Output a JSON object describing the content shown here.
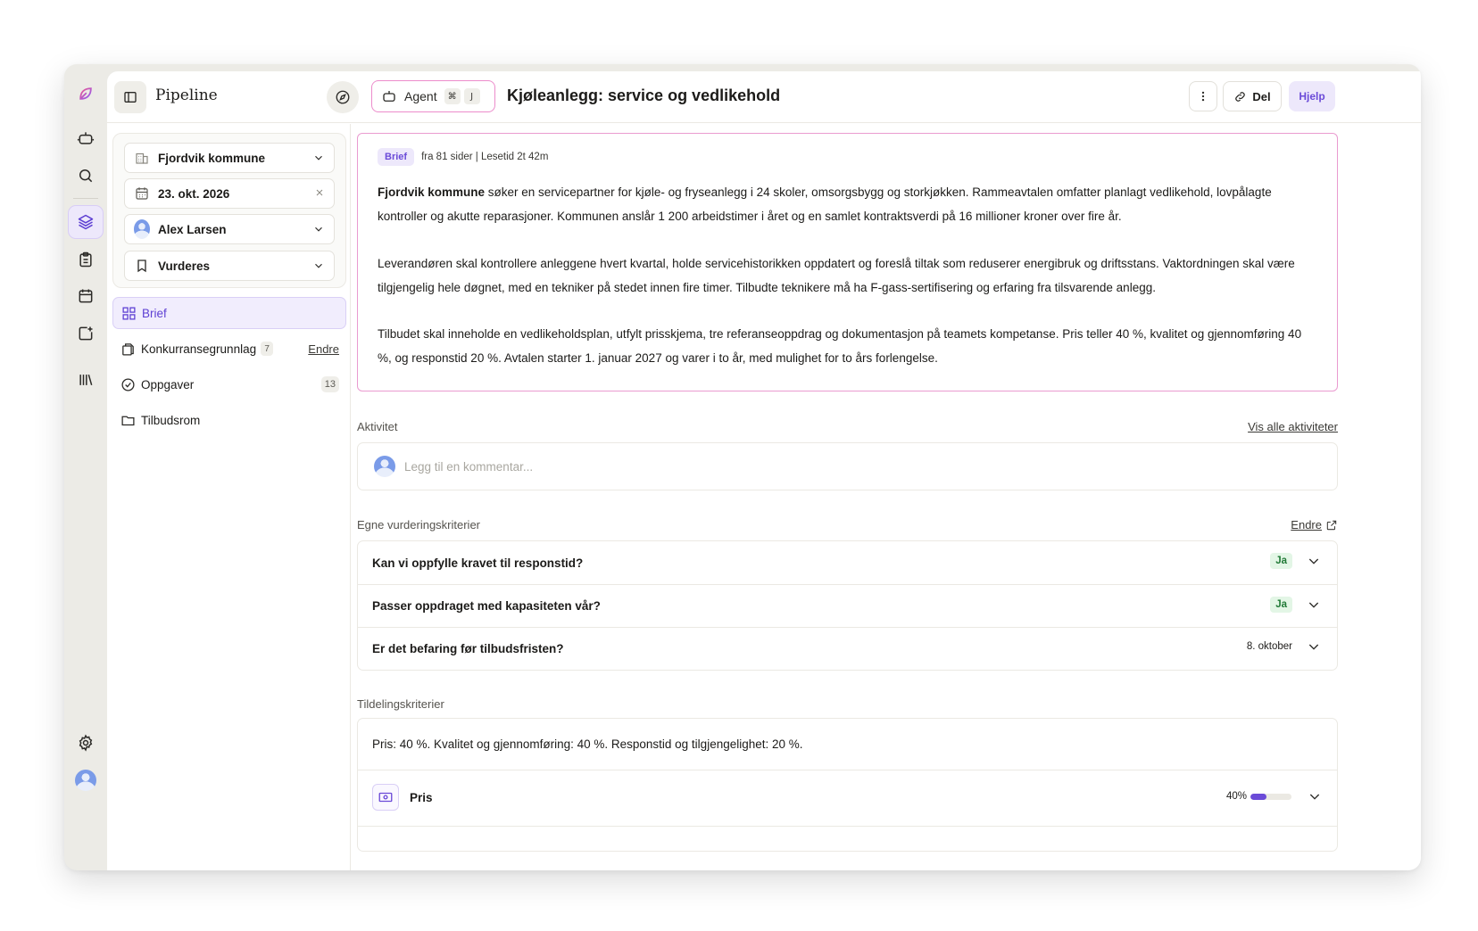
{
  "header": {
    "app_title": "Pipeline",
    "agent_label": "Agent",
    "agent_shortcut_mod": "⌘",
    "agent_shortcut_key": "J",
    "page_title": "Kjøleanlegg: service og vedlikehold",
    "share_label": "Del",
    "help_label": "Hjelp"
  },
  "filters": {
    "municipality": "Fjordvik kommune",
    "date": "23. okt. 2026",
    "assignee": "Alex Larsen",
    "status": "Vurderes"
  },
  "nav": {
    "brief": "Brief",
    "competition": "Konkurransegrunnlag",
    "competition_count": "7",
    "competition_action": "Endre",
    "tasks": "Oppgaver",
    "tasks_count": "13",
    "bidroom": "Tilbudsrom"
  },
  "brief": {
    "tag": "Brief",
    "meta": "fra 81 sider | Lesetid 2t 42m",
    "p1_bold": "Fjordvik kommune",
    "p1_rest": " søker en servicepartner for kjøle- og fryseanlegg i 24 skoler, omsorgsbygg og storkjøkken. Rammeavtalen omfatter planlagt vedlikehold, lovpålagte kontroller og akutte reparasjoner. Kommunen anslår 1 200 arbeidstimer i året og en samlet kontraktsverdi på 16 millioner kroner over fire år.",
    "p2": "Leverandøren skal kontrollere anleggene hvert kvartal, holde servicehistorikken oppdatert og foreslå tiltak som reduserer energibruk og driftsstans. Vaktordningen skal være tilgjengelig hele døgnet, med en tekniker på stedet innen fire timer. Tilbudte teknikere må ha F-gass-sertifisering og erfaring fra tilsvarende anlegg.",
    "p3": "Tilbudet skal inneholde en vedlikeholdsplan, utfylt prisskjema, tre referanseoppdrag og dokumentasjon på teamets kompetanse. Pris teller 40 %, kvalitet og gjennomføring 40 %, og responstid 20 %. Avtalen starter 1. januar 2027 og varer i to år, med mulighet for to års forlengelse."
  },
  "activity": {
    "label": "Aktivitet",
    "view_all": "Vis alle aktiviteter",
    "comment_placeholder": "Legg til en kommentar..."
  },
  "criteria": {
    "label": "Egne vurderingskriterier",
    "edit": "Endre",
    "items": [
      {
        "question": "Kan vi oppfylle kravet til responstid?",
        "answer": "Ja"
      },
      {
        "question": "Passer oppdraget med kapasiteten vår?",
        "answer": "Ja"
      },
      {
        "question": "Er det befaring før tilbudsfristen?",
        "answer": "8. oktober"
      }
    ]
  },
  "award": {
    "label": "Tildelingskriterier",
    "summary": "Pris: 40 %. Kvalitet og gjennomføring: 40 %. Responstid og tilgjengelighet: 20 %.",
    "items": [
      {
        "name": "Pris",
        "weight": "40%",
        "weight_fraction": 0.4
      }
    ]
  },
  "colors": {
    "accent": "#6b4bd8",
    "brief_border": "#ea9bd0",
    "yes_bg": "#e3f6e6",
    "yes_text": "#217a37"
  }
}
